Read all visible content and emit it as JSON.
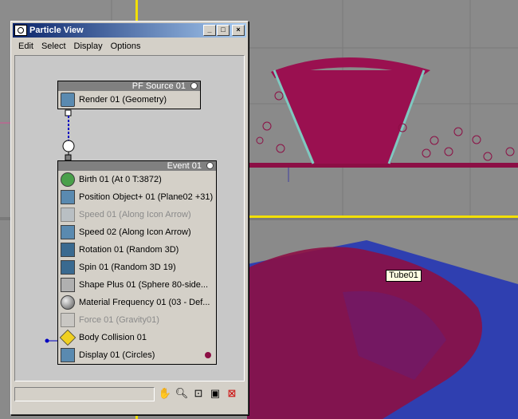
{
  "window": {
    "title": "Particle View",
    "buttons": [
      "_",
      "□",
      "×"
    ]
  },
  "menu": [
    "Edit",
    "Select",
    "Display",
    "Options"
  ],
  "source_node": {
    "title": "PF Source 01",
    "operators": [
      {
        "label": "Render 01 (Geometry)",
        "icon": "render-geometry-icon"
      }
    ]
  },
  "event_node": {
    "title": "Event 01",
    "operators": [
      {
        "label": "Birth 01 (At 0 T:3872)",
        "icon": "birth-icon",
        "enabled": true
      },
      {
        "label": "Position Object+ 01 (Plane02 +31)",
        "icon": "position-object-icon",
        "enabled": true
      },
      {
        "label": "Speed 01 (Along Icon Arrow)",
        "icon": "speed-icon",
        "enabled": false
      },
      {
        "label": "Speed 02 (Along Icon Arrow)",
        "icon": "speed-icon",
        "enabled": true
      },
      {
        "label": "Rotation 01 (Random 3D)",
        "icon": "rotation-icon",
        "enabled": true
      },
      {
        "label": "Spin 01 (Random 3D 19)",
        "icon": "spin-icon",
        "enabled": true
      },
      {
        "label": "Shape Plus 01 (Sphere 80-side...",
        "icon": "shape-icon",
        "enabled": true
      },
      {
        "label": "Material Frequency 01 (03 - Def...",
        "icon": "material-icon",
        "enabled": true
      },
      {
        "label": "Force 01 (Gravity01)",
        "icon": "force-icon",
        "enabled": false
      },
      {
        "label": "Body Collision 01",
        "icon": "collision-test-icon",
        "enabled": true
      },
      {
        "label": "Display 01 (Circles)",
        "icon": "display-icon",
        "enabled": true
      }
    ]
  },
  "tooltip": "Tube01",
  "toolbar_icons": [
    "pan-hand-icon",
    "zoom-icon",
    "zoom-region-icon",
    "zoom-extents-icon",
    "no-zoom-icon"
  ],
  "colors": {
    "particle": "#8c0f45",
    "blue_particles": "#2f3fb0",
    "tube": "#7fc8c0"
  }
}
